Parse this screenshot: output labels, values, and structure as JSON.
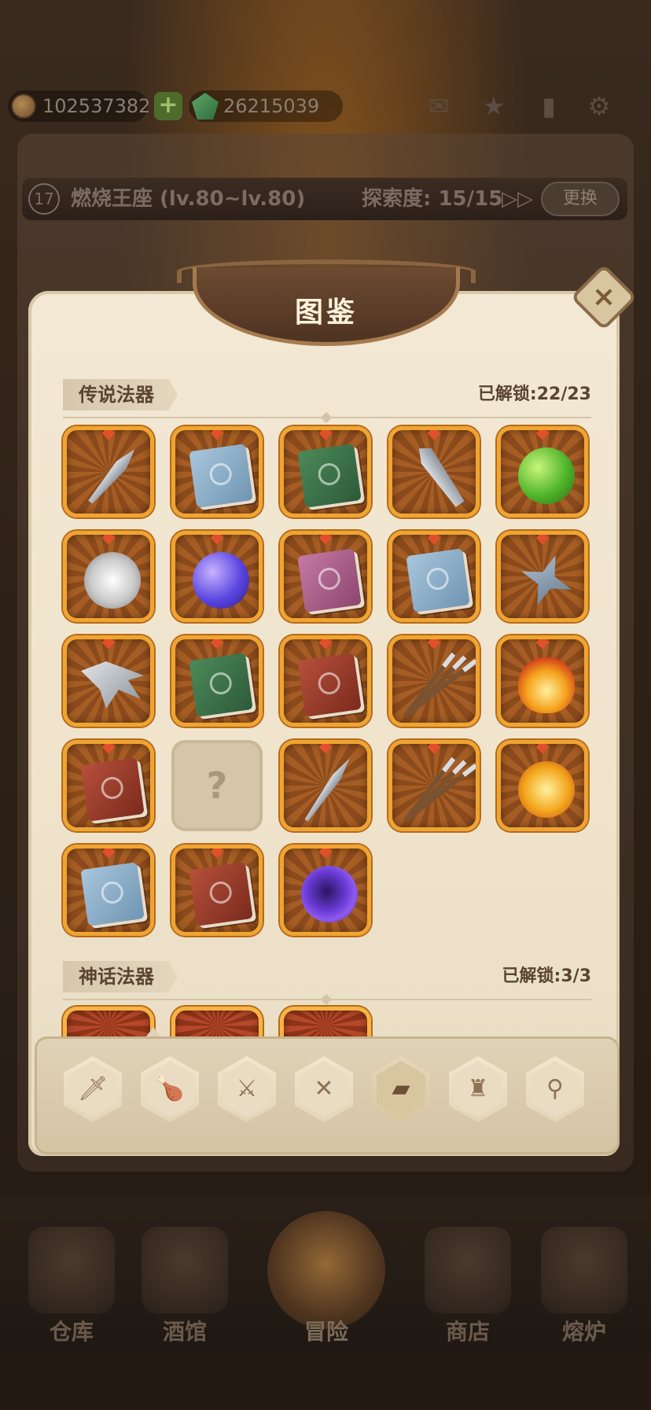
{
  "top_bar": {
    "gold_amount": "102537382",
    "gem_amount": "26215039",
    "plus_label": "+",
    "icons": [
      "mail-icon",
      "favorite-icon",
      "bookmark-icon",
      "gear-icon"
    ]
  },
  "level_bar": {
    "level": "17",
    "title": "燃烧王座 (lv.80~lv.80)",
    "explore": "探索度: 15/15",
    "ff_icon": "▷▷",
    "change_label": "更换"
  },
  "codex": {
    "title": "图鉴",
    "close_label": "×",
    "legendary": {
      "label": "传说法器",
      "unlocked": "已解锁:22/23",
      "items": [
        {
          "icon": "kunai-icon",
          "kind": "blade"
        },
        {
          "icon": "blue-book-icon",
          "kind": "book-blue"
        },
        {
          "icon": "green-book-icon",
          "kind": "book-green"
        },
        {
          "icon": "knife-icon",
          "kind": "knife"
        },
        {
          "icon": "green-orb-icon",
          "kind": "orb-green"
        },
        {
          "icon": "white-orb-icon",
          "kind": "orb-white"
        },
        {
          "icon": "planet-orb-icon",
          "kind": "orb-purple"
        },
        {
          "icon": "pink-book-icon",
          "kind": "book-pink"
        },
        {
          "icon": "blue-book-icon",
          "kind": "book-blue"
        },
        {
          "icon": "shuriken-icon",
          "kind": "shuriken"
        },
        {
          "icon": "claw-blade-icon",
          "kind": "claw"
        },
        {
          "icon": "green-book-icon",
          "kind": "book-green"
        },
        {
          "icon": "red-book-icon",
          "kind": "book-red"
        },
        {
          "icon": "spears-icon",
          "kind": "spears"
        },
        {
          "icon": "fire-orb-icon",
          "kind": "orb-flame"
        },
        {
          "icon": "red-book-icon",
          "kind": "book-red"
        },
        {
          "icon": "locked-icon",
          "kind": "locked",
          "label": "?"
        },
        {
          "icon": "dagger-icon",
          "kind": "dagger"
        },
        {
          "icon": "spears-icon",
          "kind": "spears"
        },
        {
          "icon": "sun-orb-icon",
          "kind": "orb-gold"
        },
        {
          "icon": "blue-book-icon",
          "kind": "book-blue"
        },
        {
          "icon": "red-book-icon",
          "kind": "book-red"
        },
        {
          "icon": "void-orb-icon",
          "kind": "orb-void"
        }
      ]
    },
    "mythic": {
      "label": "神话法器",
      "unlocked": "已解锁:3/3",
      "items": [
        {
          "icon": "mythic-item-1-icon"
        },
        {
          "icon": "mythic-item-2-icon"
        },
        {
          "icon": "mythic-item-3-icon"
        }
      ]
    },
    "tabs": [
      {
        "icon": "sword-icon",
        "glyph": "🗡"
      },
      {
        "icon": "drumstick-icon",
        "glyph": "🍗"
      },
      {
        "icon": "dagger-icon",
        "glyph": "⚔"
      },
      {
        "icon": "cross-icon",
        "glyph": "✕"
      },
      {
        "icon": "book-icon",
        "glyph": "▰",
        "active": true
      },
      {
        "icon": "armor-icon",
        "glyph": "♜"
      },
      {
        "icon": "ring-icon",
        "glyph": "⚲"
      }
    ]
  },
  "bottom_nav": [
    {
      "label": "仓库",
      "icon": "warehouse-icon"
    },
    {
      "label": "酒馆",
      "icon": "tavern-icon"
    },
    {
      "label": "冒险",
      "icon": "adventure-icon",
      "active": true
    },
    {
      "label": "商店",
      "icon": "shop-icon"
    },
    {
      "label": "熔炉",
      "icon": "forge-icon"
    }
  ],
  "colors": {
    "panel": "#f0e4cd",
    "tile_border": "#f0a431",
    "title_text": "#fff3dc"
  }
}
